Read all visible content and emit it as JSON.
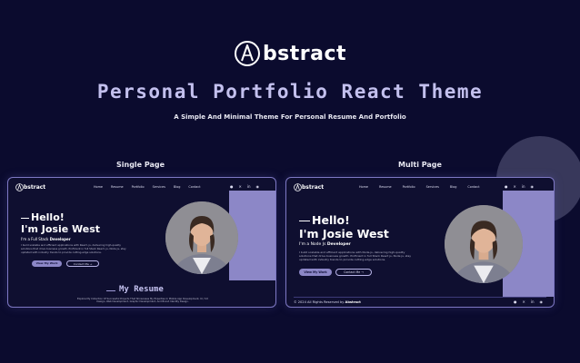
{
  "brand": {
    "logo_text": "bstract",
    "logo_icon": "abstract-a-logo-icon"
  },
  "hero": {
    "title": "Personal Portfolio React Theme",
    "subtitle": "A Simple And Minimal Theme For Personal Resume And Portfolio"
  },
  "single": {
    "label": "Single Page",
    "logo_text": "bstract",
    "nav": [
      "Home",
      "Resume",
      "Portfolio",
      "Services",
      "Blog",
      "Contact"
    ],
    "social_icons": [
      "facebook-icon",
      "x-twitter-icon",
      "linkedin-icon",
      "github-icon"
    ],
    "hello": "Hello!",
    "name": "I'm Josie West",
    "role_prefix": "I'm a Full Stack",
    "role_bold": "Developer",
    "description": "I build scalable and efficient applications with React, js, delivering high-quality solutions that drive business growth. Proficient in full Stack React, js, Node js, stay updated with industry trends to provide cutting-edge solutions.",
    "btn_primary": "View My Work",
    "btn_secondary": "Contact Me →",
    "resume_title": "My Resume",
    "resume_desc": "Explore My Collection Of Successful Projects That Showcases My Expertise In Mobile App Development, UI / UX Design, Web Development, Graphic Development, And Brand Identity Design."
  },
  "multi": {
    "label": "Multi Page",
    "logo_text": "bstract",
    "nav": [
      "Home",
      "Resume",
      "Portfolio",
      "Services",
      "Blog",
      "Contact"
    ],
    "social_icons": [
      "facebook-icon",
      "x-twitter-icon",
      "linkedin-icon",
      "github-icon"
    ],
    "hello": "Hello!",
    "name": "I'm Josie West",
    "role_prefix": "I'm a Node Js",
    "role_bold": "Developer",
    "description": "I build scalable and efficient applications with Node.js, delivering high-quality solutions that drive business growth. Proficient in full Stack React js, Node js, stay updated with industry trends to provide cutting-edge solutions.",
    "btn_primary": "View My Work",
    "btn_secondary": "Contact Me →",
    "footer_prefix": "© 2024 All Rights Reserved by",
    "footer_brand": "Abstract"
  }
}
